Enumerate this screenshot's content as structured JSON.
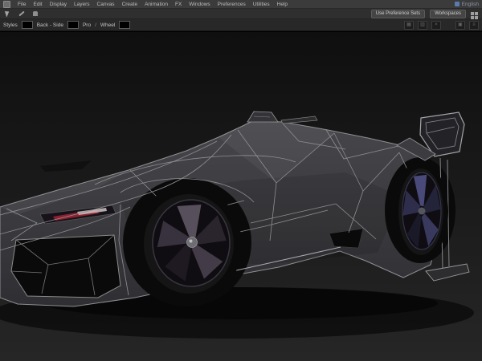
{
  "window": {
    "language_badge": {
      "label": "English"
    }
  },
  "menu_bar": {
    "items": [
      "File",
      "Edit",
      "Display",
      "Layers",
      "Canvas",
      "Create",
      "Animation",
      "FX",
      "Windows",
      "Preferences",
      "Utilities",
      "Help"
    ]
  },
  "quick_access_bar": {
    "use_preference_sets_label": "Use Preference Sets",
    "workspaces_label": "Workspaces"
  },
  "context_bar": {
    "field1_label": "Styles",
    "field2_label": "Back - Side",
    "field3_label": "Pro",
    "separator": "/",
    "field4_label": "Wheel",
    "swatch_color": "#000000",
    "close_glyph": "×"
  },
  "viewport": {
    "subject": "low-poly wireframe race car with large rear wing, front three-quarter left view",
    "colors": {
      "background_top": "#0f0f0f",
      "background_bottom": "#262626",
      "body_light": "#47474b",
      "body_dark": "#2f2f33",
      "wireframe": "#8f8f93",
      "wireframe_bright": "#a8a8ac",
      "cavity": "#0a0a0a",
      "tire": "#0a0a0a",
      "sidewall": "#151515",
      "rim_base": "#0f0d12",
      "rim_lip_front": "#3a3540",
      "rim_lip_rear": "#34344a",
      "front_spoke_0": "#57505c",
      "front_spoke_1": "#2a242c",
      "front_spoke_2": "#433c48",
      "front_spoke_3": "#1f1a22",
      "front_spoke_4": "#38313e",
      "rear_spoke_0": "#4a4a7a",
      "rear_spoke_1": "#23233a",
      "rear_spoke_2": "#39395e",
      "rear_spoke_3": "#191928",
      "rear_spoke_4": "#2e2e4c",
      "hub_front": "#6e6e72",
      "hub_rear": "#55555c",
      "headlight_red": "#8e2130",
      "headlight_white": "#cdc4c4",
      "wing_plate": "#232327"
    }
  }
}
